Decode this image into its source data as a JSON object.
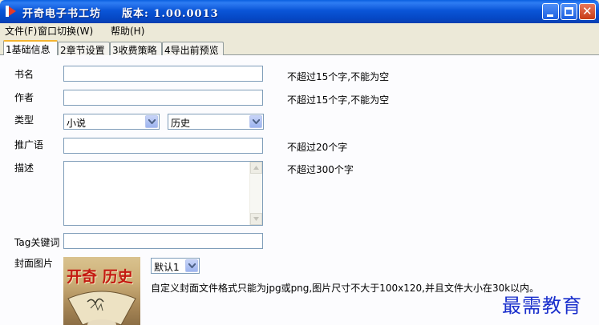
{
  "window": {
    "title": "开奇电子书工坊",
    "version": "版本: 1.00.0013"
  },
  "menu": {
    "items": [
      {
        "label": "文件(F)"
      },
      {
        "label": "窗口切换(W)"
      },
      {
        "label": "帮助(H)"
      }
    ]
  },
  "tabs": [
    {
      "label": "1基础信息",
      "active": true
    },
    {
      "label": "2章节设置",
      "active": false
    },
    {
      "label": "3收费策略",
      "active": false
    },
    {
      "label": "4导出前预览",
      "active": false
    }
  ],
  "form": {
    "book_name": {
      "label": "书名",
      "value": "",
      "hint": "不超过15个字,不能为空"
    },
    "author": {
      "label": "作者",
      "value": "",
      "hint": "不超过15个字,不能为空"
    },
    "type": {
      "label": "类型",
      "primary": "小说",
      "secondary": "历史"
    },
    "promo": {
      "label": "推广语",
      "value": "",
      "hint": "不超过20个字"
    },
    "description": {
      "label": "描述",
      "value": "",
      "hint": "不超过300个字"
    },
    "tags": {
      "label": "Tag关键词",
      "value": ""
    },
    "cover": {
      "label": "封面图片",
      "select_value": "默认1",
      "description": "自定义封面文件格式只能为jpg或png,图片尺寸不大于100x120,并且文件大小在30k以内。",
      "preview_text": "开奇 历史"
    }
  },
  "watermark": "最需教育",
  "colors": {
    "titlebar": "#0a55d8",
    "tab_highlight": "#f5b430",
    "cover_text": "#c41a12",
    "watermark": "#1a2fcc"
  }
}
